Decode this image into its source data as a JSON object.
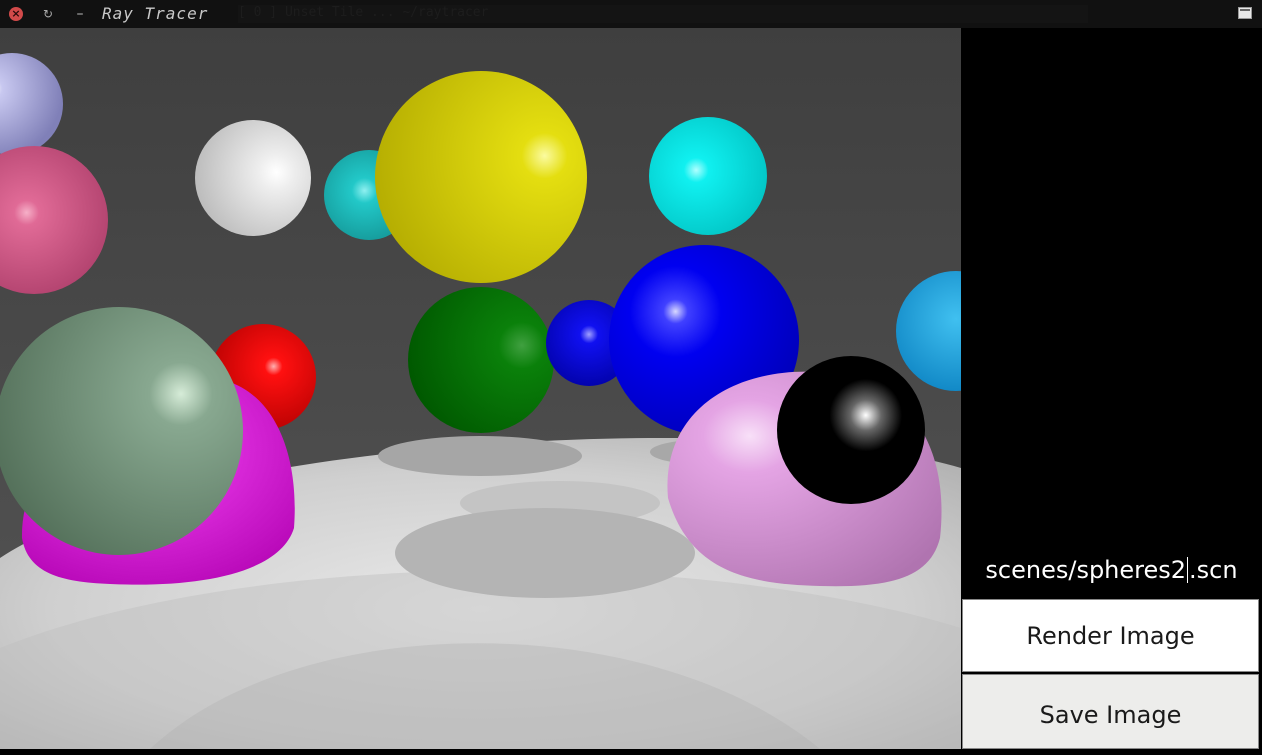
{
  "window": {
    "title": "Ray Tracer",
    "ghost_text": "[ 0 ] Unset  Tile ...  ~/raytracer"
  },
  "icons": {
    "close": "close-icon",
    "refresh": "refresh-icon",
    "minimize": "minimize-icon",
    "maximize": "maximize-icon"
  },
  "panel": {
    "filename_before_cursor": "scenes/spheres2",
    "filename_after_cursor": ".scn",
    "render_button_label": "Render Image",
    "save_button_label": "Save Image"
  },
  "colors": {
    "panel_background": "#000000",
    "button_background": "#ffffff",
    "save_button_background": "#ededeb",
    "wall": "#4a4a4a",
    "floor": "#d6d6d6"
  },
  "scene": {
    "spheres": [
      {
        "name": "lavender",
        "color": "#a8a8d8"
      },
      {
        "name": "pink",
        "color": "#d05080"
      },
      {
        "name": "white",
        "color": "#e6e6e6"
      },
      {
        "name": "cyan-back",
        "color": "#20c8c8"
      },
      {
        "name": "yellow",
        "color": "#d6d000"
      },
      {
        "name": "cyan",
        "color": "#00e8e8"
      },
      {
        "name": "light-blue",
        "color": "#1aa8e0"
      },
      {
        "name": "green",
        "color": "#0a7a0a"
      },
      {
        "name": "blue-small",
        "color": "#0000e0"
      },
      {
        "name": "blue",
        "color": "#0000f0"
      },
      {
        "name": "red",
        "color": "#ee0000"
      },
      {
        "name": "magenta",
        "color": "#e000e0"
      },
      {
        "name": "sage",
        "color": "#6a9070"
      },
      {
        "name": "light-pink",
        "color": "#e8a8e8"
      },
      {
        "name": "black",
        "color": "#000000"
      }
    ]
  }
}
